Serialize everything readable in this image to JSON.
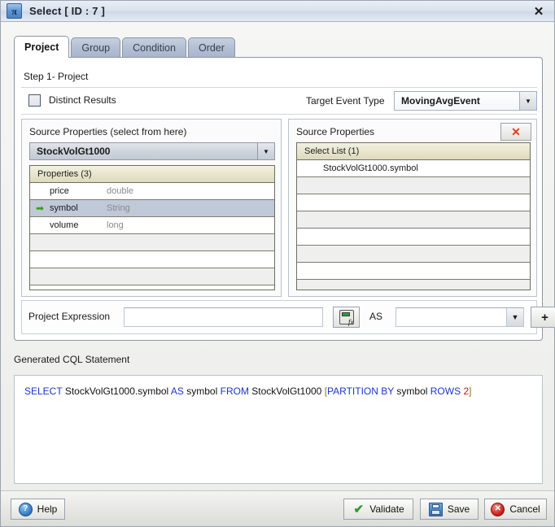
{
  "window": {
    "title": "Select [ ID : 7 ]",
    "icon": "pi-icon",
    "icon_glyph": "π",
    "close_label": "✕"
  },
  "tabs": [
    {
      "label": "Project",
      "active": true
    },
    {
      "label": "Group",
      "active": false
    },
    {
      "label": "Condition",
      "active": false
    },
    {
      "label": "Order",
      "active": false
    }
  ],
  "panel": {
    "step_label": "Step 1- Project",
    "distinct_results_label": "Distinct Results",
    "distinct_results_checked": false,
    "target_event_type_label": "Target Event Type",
    "target_event_type_value": "MovingAvgEvent",
    "dropdown_arrow": "▼"
  },
  "left_panel": {
    "title": "Source Properties (select from here)",
    "source_value": "StockVolGt1000",
    "grid_header": "Properties (3)",
    "rows": [
      {
        "selected": false,
        "arrow": "",
        "name": "price",
        "type": "double"
      },
      {
        "selected": true,
        "arrow": "➡",
        "name": "symbol",
        "type": "String"
      },
      {
        "selected": false,
        "arrow": "",
        "name": "volume",
        "type": "long"
      }
    ],
    "empty_row_count": 4
  },
  "right_panel": {
    "title": "Source Properties",
    "remove_label": "✕",
    "grid_header": "Select List (1)",
    "rows": [
      {
        "value": "StockVolGt1000.symbol"
      }
    ],
    "empty_row_count": 7
  },
  "expression": {
    "label": "Project Expression",
    "value": "",
    "placeholder": "",
    "fx_button_name": "expression-builder",
    "as_label": "AS",
    "as_value": "",
    "add_label": "+"
  },
  "cql": {
    "label": "Generated CQL Statement",
    "tokens": [
      {
        "text": "SELECT",
        "style": "kw"
      },
      {
        "text": " ",
        "style": "plain"
      },
      {
        "text": "StockVolGt1000.symbol",
        "style": "plain"
      },
      {
        "text": " ",
        "style": "plain"
      },
      {
        "text": "AS",
        "style": "kw"
      },
      {
        "text": " ",
        "style": "plain"
      },
      {
        "text": "symbol",
        "style": "plain"
      },
      {
        "text": " ",
        "style": "plain"
      },
      {
        "text": "FROM",
        "style": "kw"
      },
      {
        "text": " ",
        "style": "plain"
      },
      {
        "text": "StockVolGt1000",
        "style": "plain"
      },
      {
        "text": "  ",
        "style": "plain"
      },
      {
        "text": "[",
        "style": "brk"
      },
      {
        "text": "PARTITION BY",
        "style": "kw"
      },
      {
        "text": " ",
        "style": "plain"
      },
      {
        "text": "symbol",
        "style": "plain"
      },
      {
        "text": "  ",
        "style": "plain"
      },
      {
        "text": "ROWS",
        "style": "kw"
      },
      {
        "text": " ",
        "style": "plain"
      },
      {
        "text": "2",
        "style": "num"
      },
      {
        "text": "]",
        "style": "brk"
      }
    ],
    "full_text": "SELECT StockVolGt1000.symbol AS symbol FROM StockVolGt1000  [PARTITION BY symbol  ROWS 2]"
  },
  "footer": {
    "help_label": "Help",
    "help_glyph": "?",
    "validate_label": "Validate",
    "validate_glyph": "✔",
    "save_label": "Save",
    "cancel_label": "Cancel",
    "cancel_glyph": "✕"
  },
  "colors": {
    "accent_blue": "#1a35cf",
    "keyword_blue": "#1a35cf",
    "number_red": "#c1182b",
    "bracket_olive": "#8a7a16",
    "remove_red": "#e33b20",
    "arrow_green": "#3e9e18",
    "selection": "#c0c9d8",
    "grid_header": "#e8e5cd"
  }
}
